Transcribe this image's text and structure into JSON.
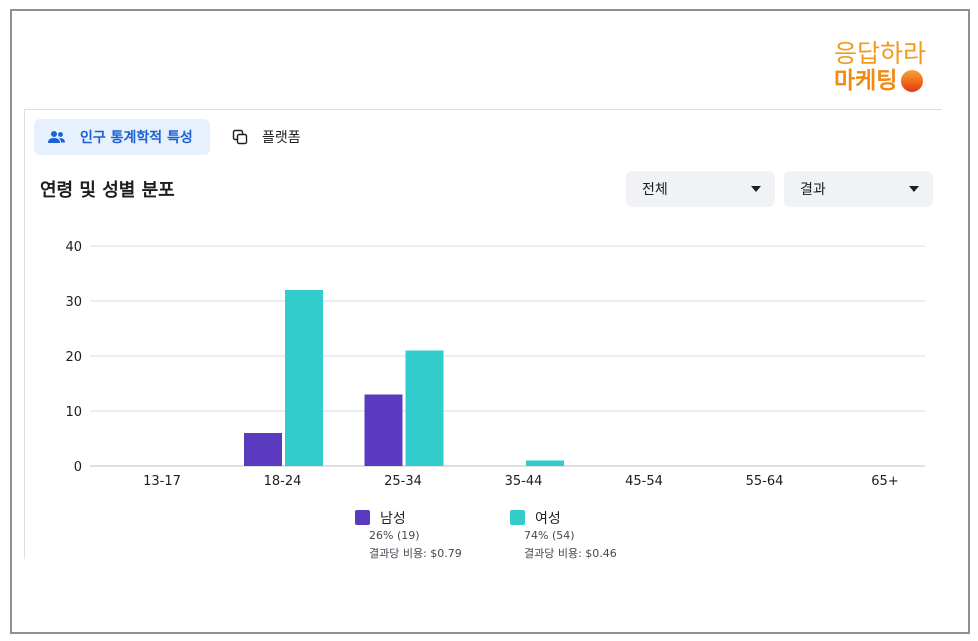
{
  "logo": {
    "line1": "응답하라",
    "line2": "마케팅"
  },
  "tabs": [
    {
      "label": "인구 통계학적 특성",
      "icon": "people-icon",
      "active": true
    },
    {
      "label": "플랫폼",
      "icon": "copy-icon",
      "active": false
    }
  ],
  "section_title": "연령 및 성별 분포",
  "dropdowns": [
    {
      "value": "전체"
    },
    {
      "value": "결과"
    }
  ],
  "colors": {
    "male": "#5a3bbf",
    "female": "#33cccc",
    "accent": "#1a62d6",
    "grid": "#dadde1"
  },
  "legend": [
    {
      "name": "남성",
      "share": "26% (19)",
      "cost": "결과당 비용: $0.79"
    },
    {
      "name": "여성",
      "share": "74% (54)",
      "cost": "결과당 비용: $0.46"
    }
  ],
  "chart_data": {
    "type": "bar",
    "categories": [
      "13-17",
      "18-24",
      "25-34",
      "35-44",
      "45-54",
      "55-64",
      "65+"
    ],
    "series": [
      {
        "name": "남성",
        "values": [
          0,
          6,
          13,
          0,
          0,
          0,
          0
        ]
      },
      {
        "name": "여성",
        "values": [
          0,
          32,
          21,
          1,
          0,
          0,
          0
        ]
      }
    ],
    "yticks": [
      0,
      10,
      20,
      30,
      40
    ],
    "ylim": [
      0,
      40
    ],
    "grid": true,
    "legend_position": "bottom-center"
  }
}
